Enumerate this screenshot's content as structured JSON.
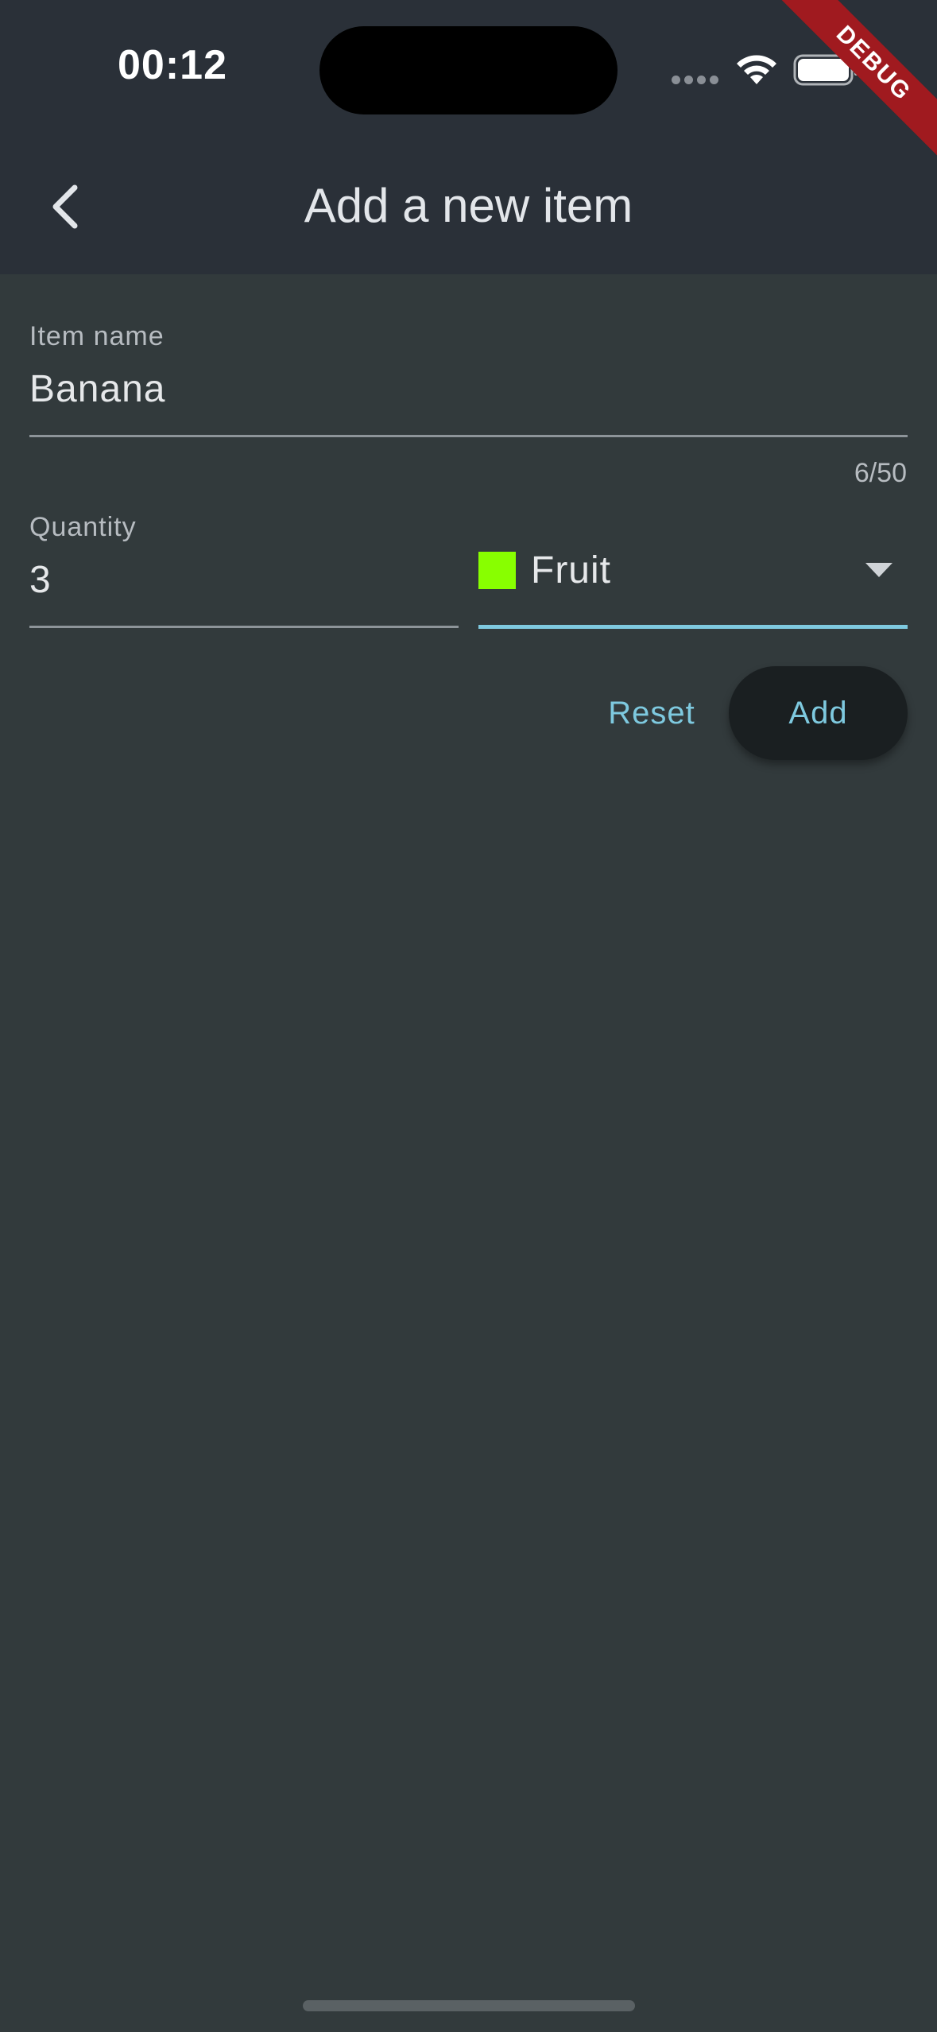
{
  "status_bar": {
    "time": "00:12",
    "debug_label": "DEBUG"
  },
  "app_bar": {
    "title": "Add a new item",
    "back_icon": "chevron-left-icon"
  },
  "form": {
    "item_name": {
      "label": "Item name",
      "value": "Banana",
      "counter": "6/50"
    },
    "quantity": {
      "label": "Quantity",
      "value": "3"
    },
    "category": {
      "selected": "Fruit",
      "swatch_color": "#88ff00",
      "arrow_icon": "dropdown-arrow-icon"
    }
  },
  "actions": {
    "reset_label": "Reset",
    "add_label": "Add"
  },
  "colors": {
    "accent": "#7ec9df",
    "background": "#323a3c",
    "app_bar": "#2a3038"
  }
}
